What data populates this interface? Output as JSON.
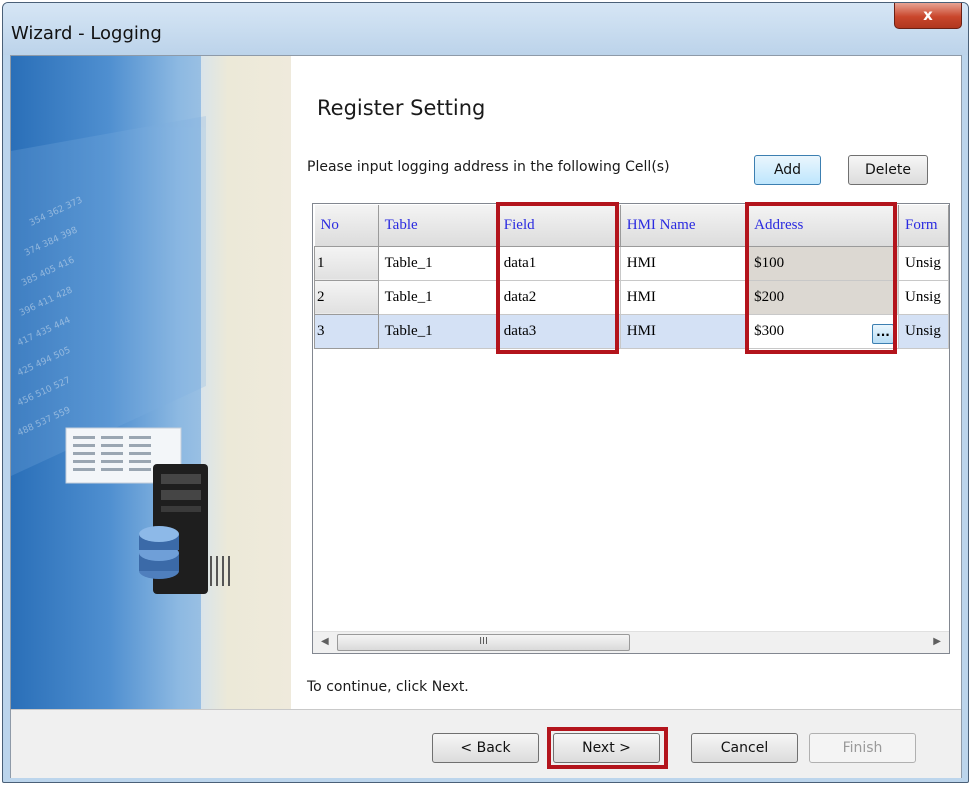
{
  "window": {
    "title": "Wizard - Logging",
    "close_label": "x"
  },
  "page": {
    "heading": "Register Setting",
    "instruction": "Please input logging address in the following Cell(s)",
    "add_label": "Add",
    "delete_label": "Delete",
    "continue_text": "To continue, click Next."
  },
  "grid": {
    "columns": [
      "No",
      "Table",
      "Field",
      "HMI Name",
      "Address",
      "Form"
    ],
    "rows": [
      {
        "no": "1",
        "table": "Table_1",
        "field": "data1",
        "hmi": "HMI",
        "address": "$100",
        "format": "Unsig"
      },
      {
        "no": "2",
        "table": "Table_1",
        "field": "data2",
        "hmi": "HMI",
        "address": "$200",
        "format": "Unsig"
      },
      {
        "no": "3",
        "table": "Table_1",
        "field": "data3",
        "hmi": "HMI",
        "address": "$300",
        "format": "Unsig"
      }
    ],
    "ellipsis_label": "...",
    "scroll_thumb_label": "III"
  },
  "footer": {
    "back_label": "< Back",
    "next_label": "Next >",
    "cancel_label": "Cancel",
    "finish_label": "Finish"
  },
  "colors": {
    "highlight": "#b3141c",
    "header_text": "#2a2ae0",
    "selected_row": "#d4e1f5"
  }
}
